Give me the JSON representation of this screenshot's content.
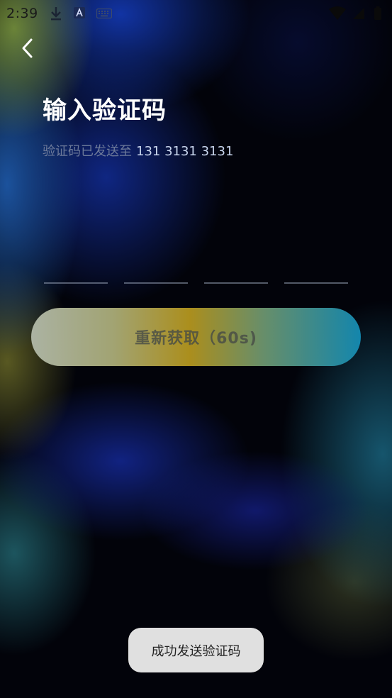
{
  "status_bar": {
    "time": "2:39",
    "icons": [
      "download-icon",
      "text-input-a-icon",
      "keyboard-icon",
      "wifi-icon",
      "signal-icon",
      "battery-icon"
    ]
  },
  "header": {
    "back_icon": "chevron-left-icon",
    "title": "输入验证码",
    "subtitle_prefix": "验证码已发送至",
    "phone": "131 3131 3131"
  },
  "code_input": {
    "slots": [
      "",
      "",
      "",
      ""
    ]
  },
  "resend": {
    "label": "重新获取（60s)"
  },
  "toast": {
    "text": "成功发送验证码"
  },
  "colors": {
    "title": "#ffffff",
    "subtitle_prefix": "#6d7a9a",
    "phone": "#c9d6ee",
    "toast_bg": "#e0e0e0"
  }
}
